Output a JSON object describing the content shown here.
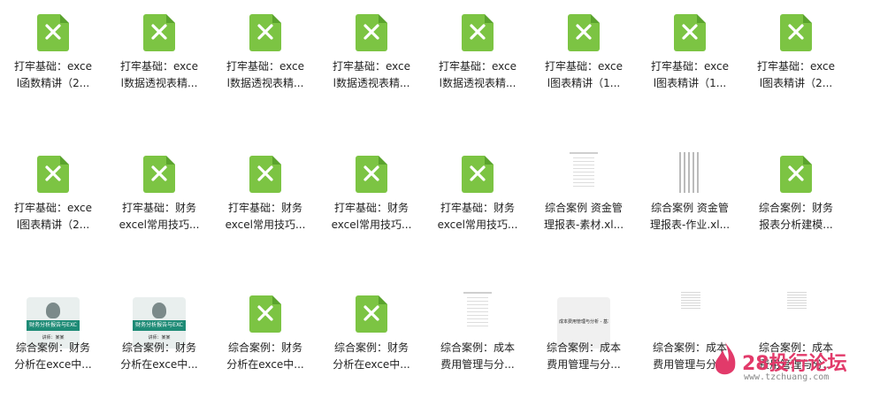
{
  "files": [
    {
      "type": "xls",
      "label": "打牢基础：exce\nl函数精讲（2..."
    },
    {
      "type": "xls",
      "label": "打牢基础：exce\nl数据透视表精..."
    },
    {
      "type": "xls",
      "label": "打牢基础：exce\nl数据透视表精..."
    },
    {
      "type": "xls",
      "label": "打牢基础：exce\nl数据透视表精..."
    },
    {
      "type": "xls",
      "label": "打牢基础：exce\nl数据透视表精..."
    },
    {
      "type": "xls",
      "label": "打牢基础：exce\nl图表精讲（1..."
    },
    {
      "type": "xls",
      "label": "打牢基础：exce\nl图表精讲（1..."
    },
    {
      "type": "xls",
      "label": "打牢基础：exce\nl图表精讲（2..."
    },
    {
      "type": "xls",
      "label": "打牢基础：exce\nl图表精讲（2..."
    },
    {
      "type": "xls",
      "label": "打牢基础：财务\nexcel常用技巧..."
    },
    {
      "type": "xls",
      "label": "打牢基础：财务\nexcel常用技巧..."
    },
    {
      "type": "xls",
      "label": "打牢基础：财务\nexcel常用技巧..."
    },
    {
      "type": "xls",
      "label": "打牢基础：财务\nexcel常用技巧..."
    },
    {
      "type": "sheet",
      "label": "综合案例 资金管\n理报表-素材.xl..."
    },
    {
      "type": "stripe",
      "label": "综合案例 资金管\n理报表-作业.xl..."
    },
    {
      "type": "xls",
      "label": "综合案例：财务\n报表分析建模..."
    },
    {
      "type": "report",
      "label": "综合案例：财务\n分析在exce中..."
    },
    {
      "type": "report",
      "label": "综合案例：财务\n分析在exce中..."
    },
    {
      "type": "xls",
      "label": "综合案例：财务\n分析在exce中..."
    },
    {
      "type": "xls",
      "label": "综合案例：财务\n分析在exce中..."
    },
    {
      "type": "sheet",
      "label": "综合案例：成本\n费用管理与分..."
    },
    {
      "type": "pptcard",
      "label": "综合案例：成本\n费用管理与分..."
    },
    {
      "type": "tiny",
      "label": "综合案例：成本\n费用管理与分..."
    },
    {
      "type": "tiny",
      "label": "综合案例：成本\n费用管理与分..."
    }
  ],
  "report_thumb": {
    "band": "财务分析报告与EXC",
    "small": "讲师：某某"
  },
  "ppt_thumb": {
    "title": "成本费用管理与分析 - 基本利"
  },
  "watermark": {
    "brand": "28投行论坛",
    "url": "www.tzchuang.com"
  },
  "colors": {
    "xls_green": "#7cc443",
    "accent": "#e23a6a"
  }
}
